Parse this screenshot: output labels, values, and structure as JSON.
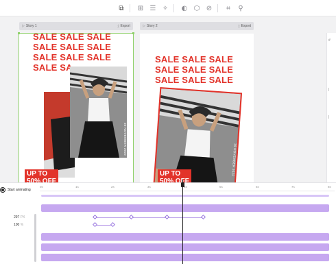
{
  "toolbar": {
    "icons": [
      "select-frame-icon",
      "grid-icon",
      "list-icon",
      "magic-icon",
      "contrast-icon",
      "shapes-icon",
      "mask-icon",
      "crop-icon",
      "adjust-icon"
    ]
  },
  "stories": [
    {
      "label": "Story 1",
      "export_label": "Export"
    },
    {
      "label": "Story 2",
      "export_label": "Export"
    }
  ],
  "design": {
    "sale_lines": [
      "SALE SALE SALE",
      "SALE SALE SALE",
      "SALE SALE SALE",
      "SALE SA"
    ],
    "sale_lines_2": [
      "SALE SALE SALE",
      "SALE SALE SALE",
      "SALE SALE SALE"
    ],
    "badge_text": "UP TO\n50% OFF",
    "vertical_text": "30 NOVEMBER 2022",
    "accent": "#e2332a"
  },
  "timeline": {
    "start_label": "Start animating",
    "ticks": [
      "0s",
      "1s",
      "2s",
      "3s",
      "4s",
      "5s",
      "6s",
      "7s",
      "8s"
    ],
    "properties": [
      {
        "value": "297",
        "unit": "PX"
      },
      {
        "value": "100",
        "unit": "%"
      }
    ],
    "bar_color": "#c6a8f0"
  }
}
